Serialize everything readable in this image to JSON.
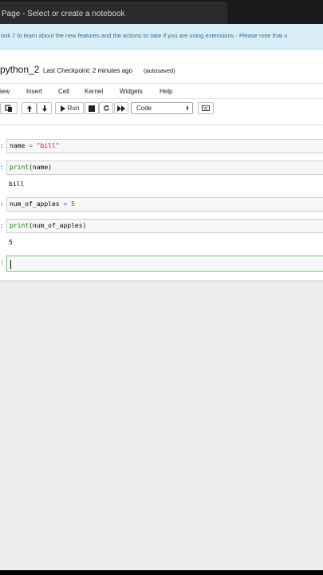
{
  "browser": {
    "tab_title": "Page - Select or create a notebook"
  },
  "banner": {
    "text": "ook 7 to learn about the new features and the actions to take if you are using extensions - Please note that u"
  },
  "notebook": {
    "name": "python_2",
    "checkpoint": "Last Checkpoint: 2 minutes ago",
    "autosave": "(autosaved)"
  },
  "menu": {
    "items": [
      "iew",
      "Insert",
      "Cell",
      "Kernel",
      "Widgets",
      "Help"
    ]
  },
  "toolbar": {
    "run_label": "Run",
    "cell_type": "Code",
    "cell_type_caret": "⬍"
  },
  "cells": [
    {
      "prompt": ":",
      "code_parts": {
        "a": "name",
        "b": " = ",
        "c": "\"bill\""
      }
    },
    {
      "prompt": ":",
      "code_parts": {
        "a": "print",
        "b": "(name)"
      },
      "output": "bill"
    },
    {
      "prompt": ":",
      "code_parts": {
        "a": "num_of_apples",
        "b": " = ",
        "c": "5"
      }
    },
    {
      "prompt": ":",
      "code_parts": {
        "a": "print",
        "b": "(num_of_apples)"
      },
      "output": "5"
    },
    {
      "prompt": ":"
    }
  ]
}
